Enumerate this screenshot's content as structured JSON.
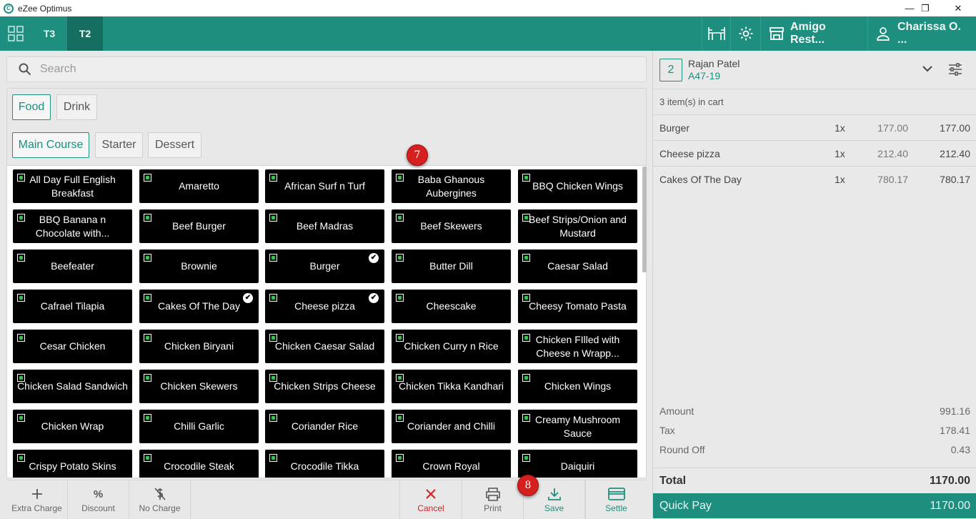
{
  "window": {
    "title": "eZee Optimus",
    "logo": "C"
  },
  "topbar": {
    "tabs": [
      {
        "label": "T3"
      },
      {
        "label": "T2"
      }
    ],
    "outlet": "Amigo Rest...",
    "user": "Charissa O. ..."
  },
  "search": {
    "placeholder": "Search"
  },
  "categories": {
    "primary": [
      "Food",
      "Drink"
    ],
    "secondary": [
      "Main Course",
      "Starter",
      "Dessert"
    ]
  },
  "items": [
    {
      "name": "All Day Full English Breakfast",
      "checked": false
    },
    {
      "name": "Amaretto",
      "checked": false
    },
    {
      "name": "African Surf n Turf",
      "checked": false
    },
    {
      "name": "Baba Ghanous Aubergines",
      "checked": false
    },
    {
      "name": "BBQ Chicken Wings",
      "checked": false
    },
    {
      "name": "BBQ Banana n Chocolate with...",
      "checked": false
    },
    {
      "name": "Beef Burger",
      "checked": false
    },
    {
      "name": "Beef Madras",
      "checked": false
    },
    {
      "name": "Beef Skewers",
      "checked": false
    },
    {
      "name": "Beef Strips/Onion and Mustard",
      "checked": false
    },
    {
      "name": "Beefeater",
      "checked": false
    },
    {
      "name": "Brownie",
      "checked": false
    },
    {
      "name": "Burger",
      "checked": true
    },
    {
      "name": "Butter Dill",
      "checked": false
    },
    {
      "name": "Caesar Salad",
      "checked": false
    },
    {
      "name": "Cafrael Tilapia",
      "checked": false
    },
    {
      "name": "Cakes Of The Day",
      "checked": true
    },
    {
      "name": "Cheese pizza",
      "checked": true
    },
    {
      "name": "Cheescake",
      "checked": false
    },
    {
      "name": "Cheesy Tomato Pasta",
      "checked": false
    },
    {
      "name": "Cesar Chicken",
      "checked": false
    },
    {
      "name": "Chicken Biryani",
      "checked": false
    },
    {
      "name": "Chicken Caesar Salad",
      "checked": false
    },
    {
      "name": "Chicken Curry n Rice",
      "checked": false
    },
    {
      "name": "Chicken FIlled with Cheese n Wrapp...",
      "checked": false
    },
    {
      "name": "Chicken Salad Sandwich",
      "checked": false
    },
    {
      "name": "Chicken Skewers",
      "checked": false
    },
    {
      "name": "Chicken Strips Cheese",
      "checked": false
    },
    {
      "name": "Chicken Tikka Kandhari",
      "checked": false
    },
    {
      "name": "Chicken Wings",
      "checked": false
    },
    {
      "name": "Chicken Wrap",
      "checked": false
    },
    {
      "name": "Chilli Garlic",
      "checked": false
    },
    {
      "name": "Coriander Rice",
      "checked": false
    },
    {
      "name": "Coriander and Chilli",
      "checked": false
    },
    {
      "name": "Creamy Mushroom Sauce",
      "checked": false
    },
    {
      "name": "Crispy Potato Skins",
      "checked": false
    },
    {
      "name": "Crocodile Steak",
      "checked": false
    },
    {
      "name": "Crocodile Tikka",
      "checked": false
    },
    {
      "name": "Crown Royal",
      "checked": false
    },
    {
      "name": "Daiquiri",
      "checked": false
    }
  ],
  "annotations": {
    "badge_grid": "7",
    "badge_save": "8"
  },
  "actions": {
    "extra_charge": "Extra Charge",
    "discount": "Discount",
    "no_charge": "No Charge",
    "cancel": "Cancel",
    "print": "Print",
    "save": "Save",
    "settle": "Settle",
    "discount_symbol": "%"
  },
  "order": {
    "table": "2",
    "customer": "Rajan Patel",
    "room": "A47-19",
    "count_text": "3 item(s) in cart",
    "lines": [
      {
        "name": "Burger",
        "qty": "1x",
        "rate": "177.00",
        "amount": "177.00"
      },
      {
        "name": "Cheese pizza",
        "qty": "1x",
        "rate": "212.40",
        "amount": "212.40"
      },
      {
        "name": "Cakes Of The Day",
        "qty": "1x",
        "rate": "780.17",
        "amount": "780.17"
      }
    ],
    "summary": [
      {
        "label": "Amount",
        "value": "991.16"
      },
      {
        "label": "Tax",
        "value": "178.41"
      },
      {
        "label": "Round Off",
        "value": "0.43"
      }
    ],
    "total_label": "Total",
    "total": "1170.00",
    "quick_pay_label": "Quick Pay",
    "quick_pay": "1170.00"
  },
  "colors": {
    "accent": "#1e8f7e",
    "cancel": "#d62020",
    "tile": "#000000",
    "veg_dot": "#2ecc4a"
  }
}
